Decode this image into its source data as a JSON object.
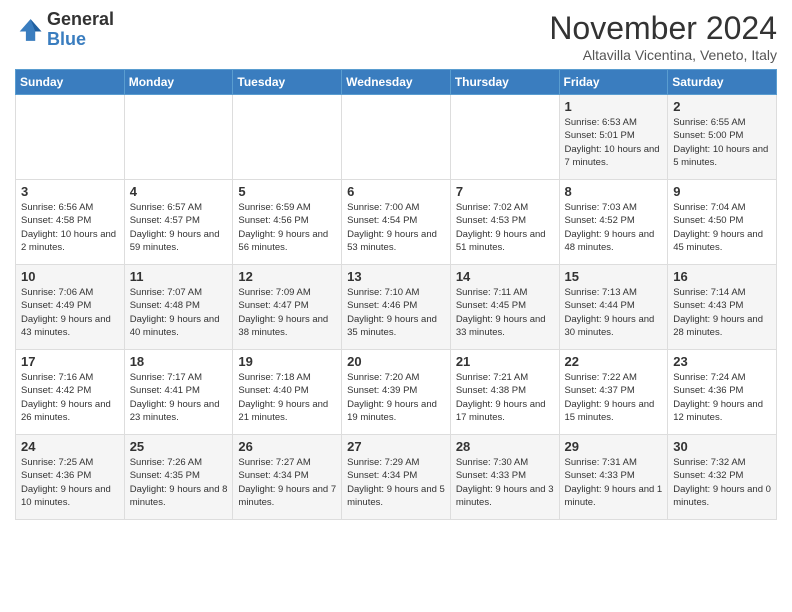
{
  "header": {
    "logo_line1": "General",
    "logo_line2": "Blue",
    "month_title": "November 2024",
    "subtitle": "Altavilla Vicentina, Veneto, Italy"
  },
  "weekdays": [
    "Sunday",
    "Monday",
    "Tuesday",
    "Wednesday",
    "Thursday",
    "Friday",
    "Saturday"
  ],
  "weeks": [
    [
      {
        "day": "",
        "info": ""
      },
      {
        "day": "",
        "info": ""
      },
      {
        "day": "",
        "info": ""
      },
      {
        "day": "",
        "info": ""
      },
      {
        "day": "",
        "info": ""
      },
      {
        "day": "1",
        "info": "Sunrise: 6:53 AM\nSunset: 5:01 PM\nDaylight: 10 hours and 7 minutes."
      },
      {
        "day": "2",
        "info": "Sunrise: 6:55 AM\nSunset: 5:00 PM\nDaylight: 10 hours and 5 minutes."
      }
    ],
    [
      {
        "day": "3",
        "info": "Sunrise: 6:56 AM\nSunset: 4:58 PM\nDaylight: 10 hours and 2 minutes."
      },
      {
        "day": "4",
        "info": "Sunrise: 6:57 AM\nSunset: 4:57 PM\nDaylight: 9 hours and 59 minutes."
      },
      {
        "day": "5",
        "info": "Sunrise: 6:59 AM\nSunset: 4:56 PM\nDaylight: 9 hours and 56 minutes."
      },
      {
        "day": "6",
        "info": "Sunrise: 7:00 AM\nSunset: 4:54 PM\nDaylight: 9 hours and 53 minutes."
      },
      {
        "day": "7",
        "info": "Sunrise: 7:02 AM\nSunset: 4:53 PM\nDaylight: 9 hours and 51 minutes."
      },
      {
        "day": "8",
        "info": "Sunrise: 7:03 AM\nSunset: 4:52 PM\nDaylight: 9 hours and 48 minutes."
      },
      {
        "day": "9",
        "info": "Sunrise: 7:04 AM\nSunset: 4:50 PM\nDaylight: 9 hours and 45 minutes."
      }
    ],
    [
      {
        "day": "10",
        "info": "Sunrise: 7:06 AM\nSunset: 4:49 PM\nDaylight: 9 hours and 43 minutes."
      },
      {
        "day": "11",
        "info": "Sunrise: 7:07 AM\nSunset: 4:48 PM\nDaylight: 9 hours and 40 minutes."
      },
      {
        "day": "12",
        "info": "Sunrise: 7:09 AM\nSunset: 4:47 PM\nDaylight: 9 hours and 38 minutes."
      },
      {
        "day": "13",
        "info": "Sunrise: 7:10 AM\nSunset: 4:46 PM\nDaylight: 9 hours and 35 minutes."
      },
      {
        "day": "14",
        "info": "Sunrise: 7:11 AM\nSunset: 4:45 PM\nDaylight: 9 hours and 33 minutes."
      },
      {
        "day": "15",
        "info": "Sunrise: 7:13 AM\nSunset: 4:44 PM\nDaylight: 9 hours and 30 minutes."
      },
      {
        "day": "16",
        "info": "Sunrise: 7:14 AM\nSunset: 4:43 PM\nDaylight: 9 hours and 28 minutes."
      }
    ],
    [
      {
        "day": "17",
        "info": "Sunrise: 7:16 AM\nSunset: 4:42 PM\nDaylight: 9 hours and 26 minutes."
      },
      {
        "day": "18",
        "info": "Sunrise: 7:17 AM\nSunset: 4:41 PM\nDaylight: 9 hours and 23 minutes."
      },
      {
        "day": "19",
        "info": "Sunrise: 7:18 AM\nSunset: 4:40 PM\nDaylight: 9 hours and 21 minutes."
      },
      {
        "day": "20",
        "info": "Sunrise: 7:20 AM\nSunset: 4:39 PM\nDaylight: 9 hours and 19 minutes."
      },
      {
        "day": "21",
        "info": "Sunrise: 7:21 AM\nSunset: 4:38 PM\nDaylight: 9 hours and 17 minutes."
      },
      {
        "day": "22",
        "info": "Sunrise: 7:22 AM\nSunset: 4:37 PM\nDaylight: 9 hours and 15 minutes."
      },
      {
        "day": "23",
        "info": "Sunrise: 7:24 AM\nSunset: 4:36 PM\nDaylight: 9 hours and 12 minutes."
      }
    ],
    [
      {
        "day": "24",
        "info": "Sunrise: 7:25 AM\nSunset: 4:36 PM\nDaylight: 9 hours and 10 minutes."
      },
      {
        "day": "25",
        "info": "Sunrise: 7:26 AM\nSunset: 4:35 PM\nDaylight: 9 hours and 8 minutes."
      },
      {
        "day": "26",
        "info": "Sunrise: 7:27 AM\nSunset: 4:34 PM\nDaylight: 9 hours and 7 minutes."
      },
      {
        "day": "27",
        "info": "Sunrise: 7:29 AM\nSunset: 4:34 PM\nDaylight: 9 hours and 5 minutes."
      },
      {
        "day": "28",
        "info": "Sunrise: 7:30 AM\nSunset: 4:33 PM\nDaylight: 9 hours and 3 minutes."
      },
      {
        "day": "29",
        "info": "Sunrise: 7:31 AM\nSunset: 4:33 PM\nDaylight: 9 hours and 1 minute."
      },
      {
        "day": "30",
        "info": "Sunrise: 7:32 AM\nSunset: 4:32 PM\nDaylight: 9 hours and 0 minutes."
      }
    ]
  ]
}
